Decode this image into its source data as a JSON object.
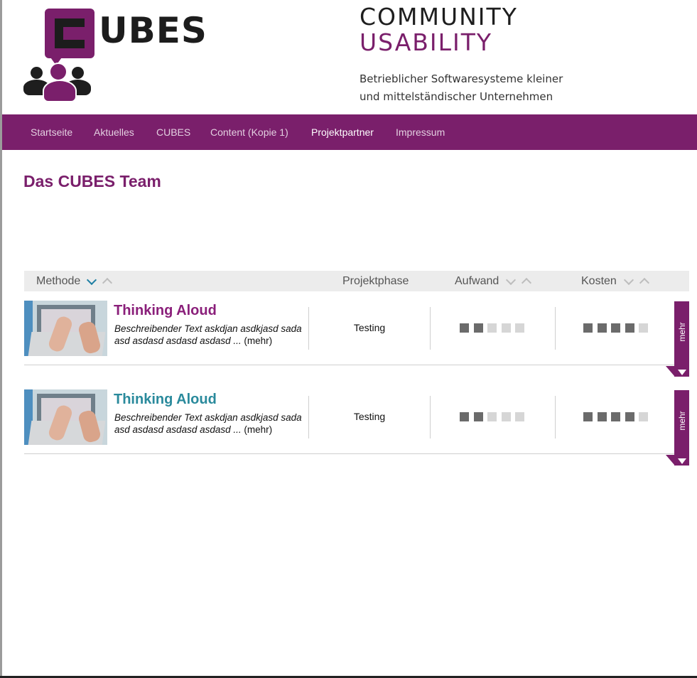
{
  "header": {
    "logo_text": "CUBES",
    "logo_first_letter": "C",
    "logo_rest": "UBES",
    "title_line1": "COMMUNITY",
    "title_line2": "USABILITY",
    "subtitle_line1": "Betrieblicher Softwaresysteme kleiner",
    "subtitle_line2": "und mittelständischer Unternehmen"
  },
  "nav": {
    "items": [
      {
        "label": "Startseite",
        "active": false
      },
      {
        "label": "Aktuelles",
        "active": false
      },
      {
        "label": "CUBES",
        "active": false
      },
      {
        "label": "Content (Kopie 1)",
        "active": false
      },
      {
        "label": "Projektpartner",
        "active": true
      },
      {
        "label": "Impressum",
        "active": false
      }
    ]
  },
  "page": {
    "title": "Das CUBES Team"
  },
  "table": {
    "headers": {
      "method": "Methode",
      "phase": "Projektphase",
      "effort": "Aufwand",
      "cost": "Kosten"
    },
    "rows": [
      {
        "title": "Thinking Aloud",
        "title_color": "#8a1f7a",
        "description": "Beschreibender Text askdjan asdkjasd sada asd asdasd asdasd asdasd ...",
        "more_link": "(mehr)",
        "phase": "Testing",
        "effort_level": 2,
        "effort_max": 5,
        "cost_level": 4,
        "cost_max": 5,
        "tab_label": "mehr"
      },
      {
        "title": "Thinking Aloud",
        "title_color": "#2a8a9c",
        "description": "Beschreibender Text askdjan asdkjasd sada asd asdasd asdasd asdasd ...",
        "more_link": "(mehr)",
        "phase": "Testing",
        "effort_level": 2,
        "effort_max": 5,
        "cost_level": 4,
        "cost_max": 5,
        "tab_label": "mehr"
      }
    ]
  },
  "colors": {
    "brand_purple": "#7a1f6b",
    "sort_active": "#1e7fa3",
    "square_on": "#6b6b6b",
    "square_off": "#d6d6d6"
  },
  "icons": {
    "sort_down": "chevron-down-icon",
    "sort_up": "chevron-up-icon",
    "expand": "caret-down-icon"
  }
}
